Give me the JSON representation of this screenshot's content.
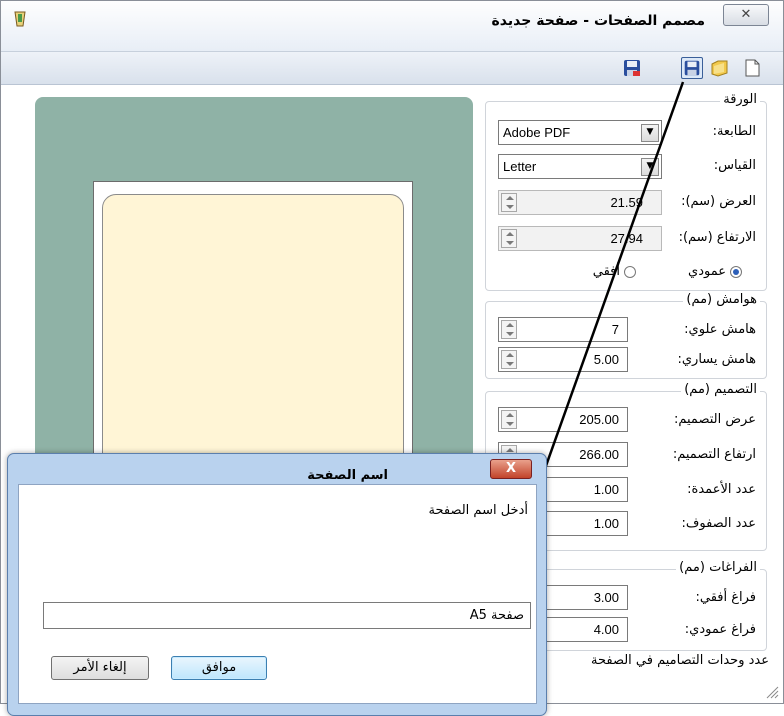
{
  "window": {
    "title": "مصمم الصفحات - صفحة جديدة",
    "close_glyph": "✕"
  },
  "toolbar": {
    "icons": [
      "new-icon",
      "open-icon",
      "save-icon",
      "save-as-icon"
    ]
  },
  "paper_group": {
    "title": "الورقة",
    "printer_label": "الطابعة:",
    "printer_value": "Adobe PDF",
    "size_label": "القياس:",
    "size_value": "Letter",
    "width_label": "العرض (سم):",
    "width_value": "21.59",
    "height_label": "الارتفاع (سم):",
    "height_value": "27.94",
    "portrait_label": "عمودي",
    "landscape_label": "أفقي"
  },
  "margins_group": {
    "title": "هوامش (مم)",
    "top_label": "هامش علوي:",
    "top_value": "7",
    "left_label": "هامش يساري:",
    "left_value": "5.00"
  },
  "design_group": {
    "title": "التصميم (مم)",
    "width_label": "عرض التصميم:",
    "width_value": "205.00",
    "height_label": "ارتفاع التصميم:",
    "height_value": "266.00",
    "cols_label": "عدد الأعمدة:",
    "cols_value": "1.00",
    "rows_label": "عدد الصفوف:",
    "rows_value": "1.00"
  },
  "gaps_group": {
    "title": "الفراغات (مم)",
    "horizontal_label": "فراغ أفقي:",
    "horizontal_value": "3.00",
    "vertical_label": "فراغ عمودي:",
    "vertical_value": "4.00"
  },
  "footer_text": "عدد وحدات التصاميم في الصفحة",
  "dialog": {
    "title": "اسم الصفحة",
    "close_glyph": "X",
    "prompt": "أدخل اسم الصفحة",
    "input_value": "صفحة A5",
    "ok_label": "موافق",
    "cancel_label": "إلغاء الأمر"
  },
  "colors": {
    "preview_bg": "#8fb2a6",
    "paper_fill": "#fff5d6",
    "dialog_frame": "#b9d2ee"
  }
}
